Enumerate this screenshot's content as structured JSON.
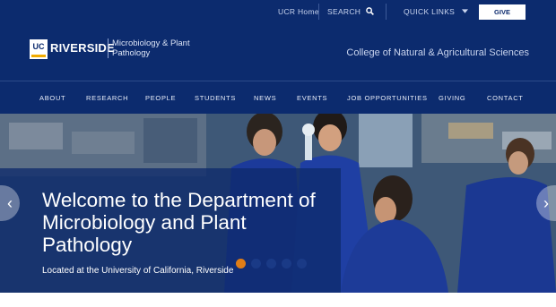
{
  "topbar": {
    "ucr_home": "UCR Home",
    "search": "SEARCH",
    "quick_links": "QUICK LINKS",
    "give": "GIVE"
  },
  "brand": {
    "logo_mark": "UC",
    "logo_word": "RIVERSIDE",
    "dept_line1": "Microbiology & Plant",
    "dept_line2": "Pathology",
    "college": "College of Natural & Agricultural Sciences"
  },
  "nav": {
    "items": [
      "ABOUT",
      "RESEARCH",
      "PEOPLE",
      "STUDENTS",
      "NEWS",
      "EVENTS",
      "JOB OPPORTUNITIES",
      "GIVING",
      "CONTACT"
    ]
  },
  "hero": {
    "title": "Welcome to the Department of Microbiology and Plant Pathology",
    "subtitle": "Located at the University of California, Riverside",
    "active_slide": 1,
    "slide_count": 5,
    "icons": {
      "prev": "chevron-left-icon",
      "next": "chevron-right-icon"
    }
  },
  "colors": {
    "brand_navy": "#0c2b6e",
    "accent_gold": "#f1ab00",
    "dot_active": "#e07d16",
    "dot_inactive": "#1a3a86"
  }
}
